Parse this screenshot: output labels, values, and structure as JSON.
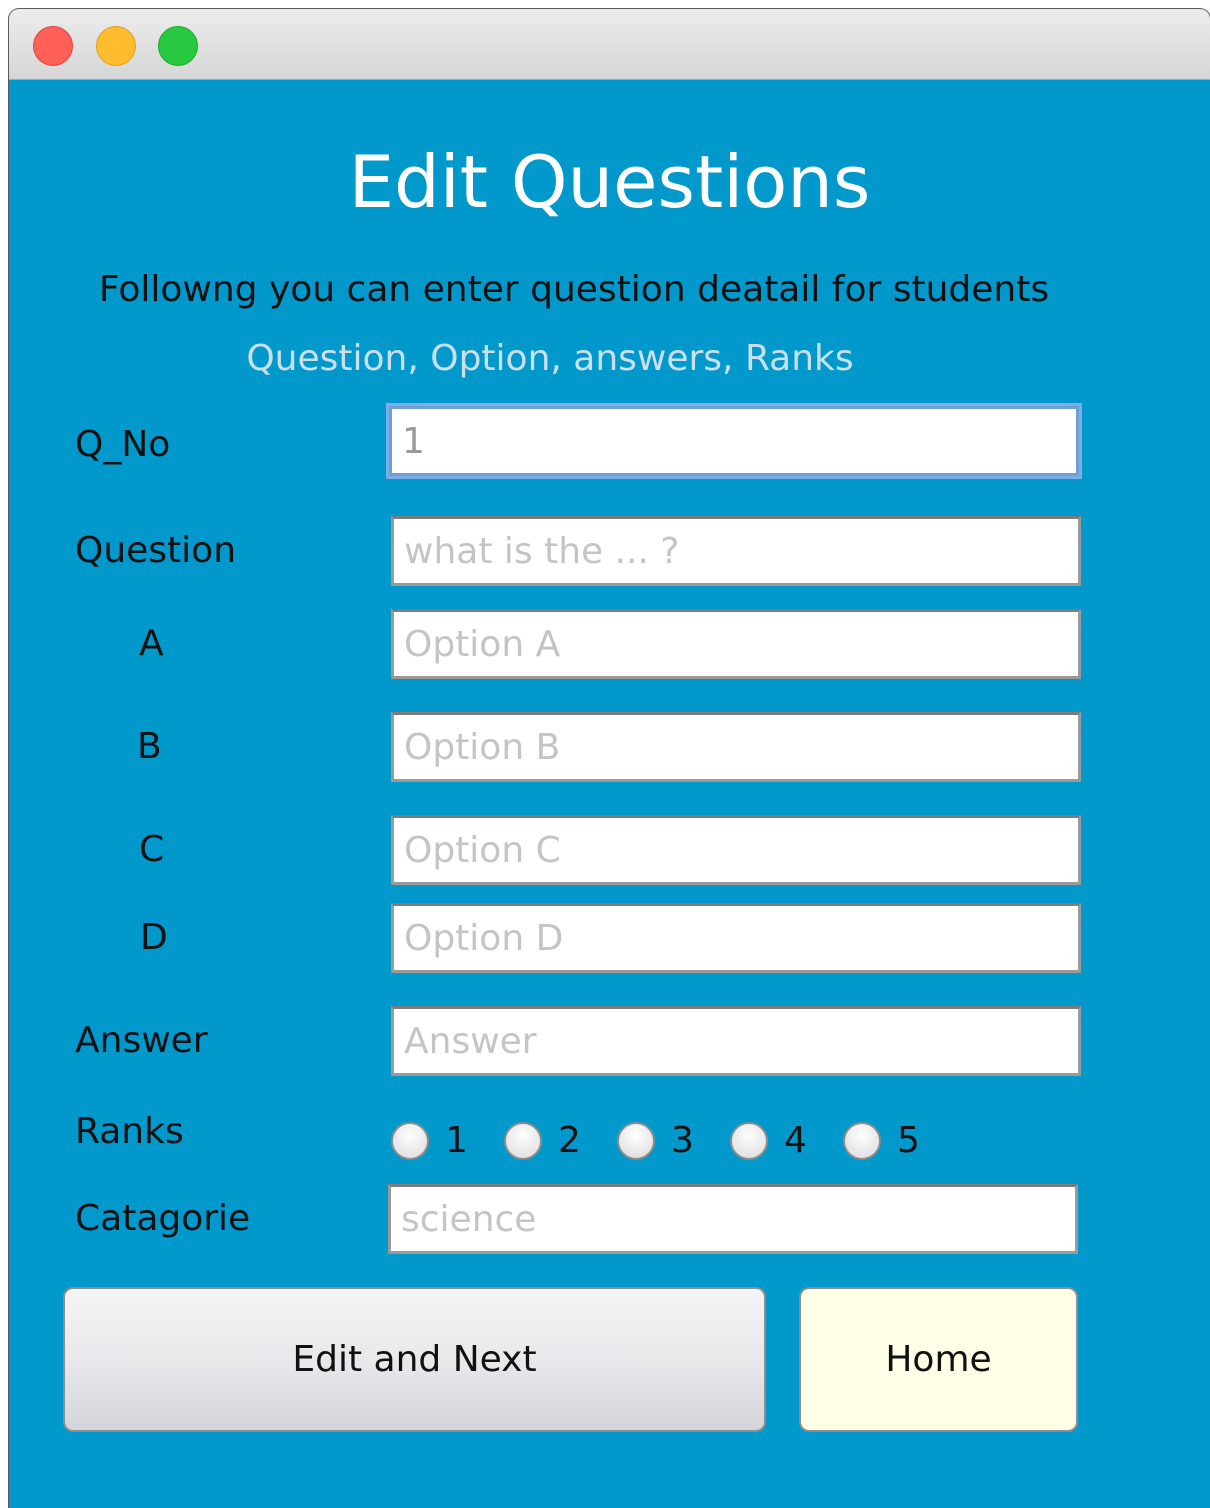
{
  "window": {
    "controls": [
      "close",
      "minimize",
      "maximize"
    ]
  },
  "header": {
    "title": "Edit Questions",
    "subtitle": "Followng you can enter question deatail for students",
    "hint": "Question, Option, answers, Ranks"
  },
  "form": {
    "qno": {
      "label": "Q_No",
      "value": "1",
      "placeholder": ""
    },
    "question": {
      "label": "Question",
      "value": "",
      "placeholder": "what is the ... ?"
    },
    "option_a": {
      "label": "A",
      "value": "",
      "placeholder": "Option A"
    },
    "option_b": {
      "label": "B",
      "value": "",
      "placeholder": "Option B"
    },
    "option_c": {
      "label": "C",
      "value": "",
      "placeholder": "Option C"
    },
    "option_d": {
      "label": "D",
      "value": "",
      "placeholder": "Option D"
    },
    "answer": {
      "label": "Answer",
      "value": "",
      "placeholder": "Answer"
    },
    "ranks": {
      "label": "Ranks",
      "options": [
        "1",
        "2",
        "3",
        "4",
        "5"
      ],
      "selected": null
    },
    "category": {
      "label": "Catagorie",
      "value": "",
      "placeholder": "science"
    }
  },
  "buttons": {
    "edit_next": "Edit and Next",
    "home": "Home"
  },
  "colors": {
    "background": "#0199cc",
    "title_text": "#ffffff",
    "hint_text": "#c9e0ea",
    "home_button": "#fefee6"
  }
}
